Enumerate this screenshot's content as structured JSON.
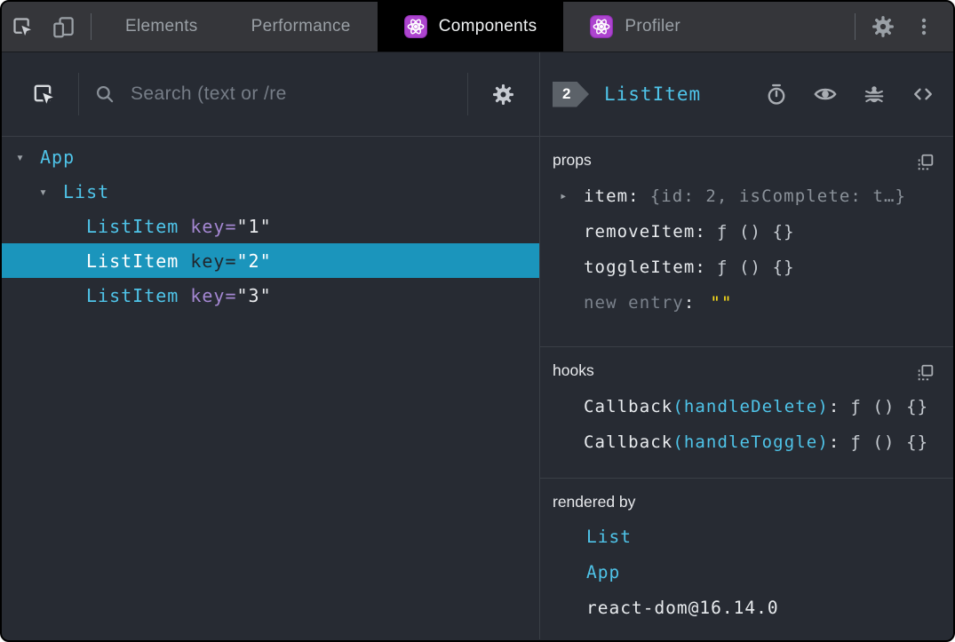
{
  "topbar": {
    "tabs": [
      {
        "label": "Elements",
        "active": false
      },
      {
        "label": "Performance",
        "active": false
      },
      {
        "label": "Components",
        "active": true
      },
      {
        "label": "Profiler",
        "active": false
      }
    ]
  },
  "left_panel": {
    "search": {
      "placeholder": "Search (text or /re",
      "value": ""
    },
    "tree": {
      "rows": [
        {
          "name": "App",
          "depth": 0,
          "expanded": true
        },
        {
          "name": "List",
          "depth": 1,
          "expanded": true
        },
        {
          "name": "ListItem",
          "depth": 2,
          "key_label": "key",
          "equals": "=",
          "key_value": "\"1\"",
          "selected": false
        },
        {
          "name": "ListItem",
          "depth": 2,
          "key_label": "key",
          "equals": "=",
          "key_value": "\"2\"",
          "selected": true
        },
        {
          "name": "ListItem",
          "depth": 2,
          "key_label": "key",
          "equals": "=",
          "key_value": "\"3\"",
          "selected": false
        }
      ]
    }
  },
  "right_panel": {
    "header": {
      "badge": "2",
      "component": "ListItem"
    },
    "props": {
      "title": "props",
      "rows": [
        {
          "key": "item",
          "colon": ":",
          "value": "{id: 2, isComplete: t…}",
          "expandable": true
        },
        {
          "key": "removeItem",
          "colon": ":",
          "value": "ƒ () {}"
        },
        {
          "key": "toggleItem",
          "colon": ":",
          "value": "ƒ () {}"
        },
        {
          "key": "new entry",
          "colon": ":",
          "value": "\"\""
        }
      ]
    },
    "hooks": {
      "title": "hooks",
      "rows": [
        {
          "name": "Callback",
          "arg": "(handleDelete)",
          "colon": ":",
          "value": "ƒ () {}"
        },
        {
          "name": "Callback",
          "arg": "(handleToggle)",
          "colon": ":",
          "value": "ƒ () {}"
        }
      ]
    },
    "rendered_by": {
      "title": "rendered by",
      "items": [
        {
          "label": "List"
        },
        {
          "label": "App"
        },
        {
          "label": "react-dom@16.14.0"
        }
      ]
    }
  },
  "icons": {
    "expander_open": "▾",
    "expander_collapsed": "▸"
  },
  "colors": {
    "accent_cyan": "#4fc4e9",
    "attr_purple": "#a487d2",
    "selected_row_bg": "#1b95bc",
    "value_yellow": "#ffe11a",
    "panel_bg": "#272b33",
    "topbar_bg": "#35363a",
    "react_purple": "#ad44cf"
  }
}
